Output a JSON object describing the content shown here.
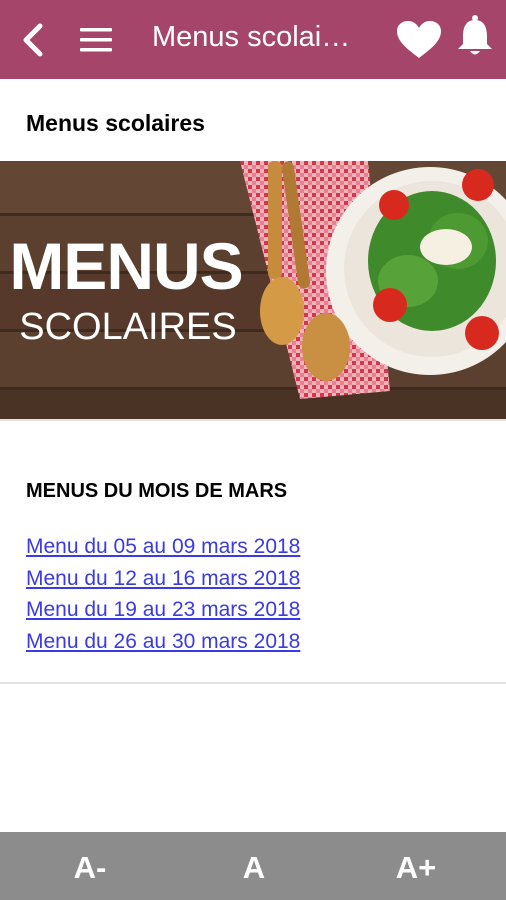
{
  "header": {
    "title": "Menus scolai…",
    "colors": {
      "background": "#a5456a",
      "foreground": "#ffffff"
    },
    "icons": [
      "back-arrow-icon",
      "hamburger-menu-icon",
      "heart-icon",
      "bell-icon"
    ]
  },
  "page": {
    "heading": "Menus scolaires",
    "banner": {
      "line1": "MENUS",
      "line2": "SCOLAIRES"
    }
  },
  "menus": {
    "heading": "MENUS DU MOIS DE MARS",
    "links": [
      "Menu du 05 au 09 mars 2018",
      "Menu du 12 au 16 mars 2018",
      "Menu du 19 au 23 mars 2018",
      "Menu du 26 au 30 mars 2018"
    ],
    "link_color": "#3a3ae6"
  },
  "fontbar": {
    "decrease": "A-",
    "normal": "A",
    "increase": "A+",
    "background": "#8c8c8c"
  }
}
